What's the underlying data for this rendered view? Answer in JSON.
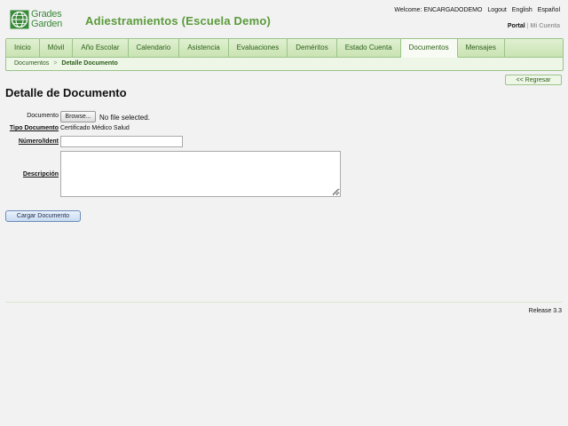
{
  "logo": {
    "line1": "Grades",
    "line2": "Garden",
    "icon": "globe-icon"
  },
  "app_title": "Adiestramientos (Escuela Demo)",
  "topbar": {
    "welcome": "Welcome: ENCARGADODEMO",
    "logout": "Logout",
    "english": "English",
    "espanol": "Español"
  },
  "portal": {
    "portal": "Portal",
    "sep": "|",
    "mi_cuenta": "Mi Cuenta"
  },
  "nav": {
    "tabs": [
      {
        "label": "Inicio"
      },
      {
        "label": "Móvil"
      },
      {
        "label": "Año Escolar"
      },
      {
        "label": "Calendario"
      },
      {
        "label": "Asistencia"
      },
      {
        "label": "Evaluaciones"
      },
      {
        "label": "Deméritos"
      },
      {
        "label": "Estado Cuenta"
      },
      {
        "label": "Documentos"
      },
      {
        "label": "Mensajes"
      }
    ],
    "active": "Documentos"
  },
  "breadcrumb": {
    "parent": "Documentos",
    "arrow": ">",
    "current": "Detalle Documento"
  },
  "back_button": "<< Regresar",
  "page_title": "Detalle de Documento",
  "form": {
    "documento_label": "Documento",
    "browse_label": "Browse...",
    "no_file": "No file selected.",
    "tipo_label": "Tipo Documento",
    "tipo_value": "Certificado Médico Salud",
    "numero_label": "Número/Ident",
    "numero_value": "",
    "descripcion_label": "Descripción",
    "descripcion_value": ""
  },
  "upload_button": "Cargar Documento",
  "footer": {
    "release": "Release 3.3"
  }
}
